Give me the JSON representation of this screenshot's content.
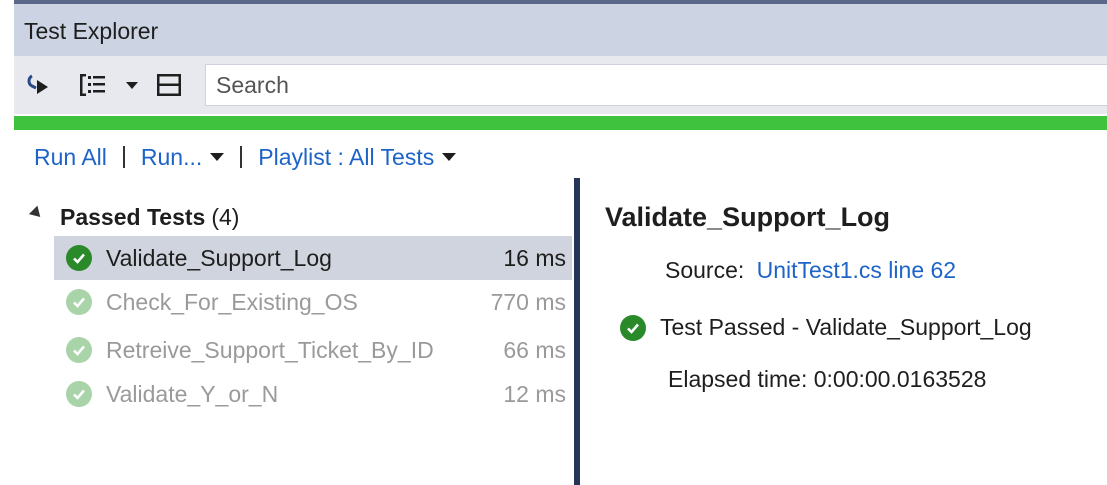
{
  "window": {
    "title": "Test Explorer"
  },
  "toolbar": {
    "icons": [
      "run-test-icon",
      "group-by-icon",
      "dropdown-caret-icon",
      "playlist-icon"
    ],
    "search_placeholder": "Search"
  },
  "progress": {
    "status": "passed",
    "fraction": 1.0,
    "color": "#3fc33f"
  },
  "commands": {
    "run_all": "Run All",
    "run": "Run...",
    "playlist": "Playlist : All Tests"
  },
  "test_list": {
    "group": {
      "title": "Passed Tests",
      "count": "(4)"
    },
    "items": [
      {
        "name": "Validate_Support_Log",
        "duration": "16 ms",
        "selected": true
      },
      {
        "name": "Check_For_Existing_OS",
        "duration": "770 ms",
        "selected": false
      },
      {
        "name": "Retreive_Support_Ticket_By_ID",
        "duration": "66 ms",
        "selected": false
      },
      {
        "name": "Validate_Y_or_N",
        "duration": "12 ms",
        "selected": false
      }
    ]
  },
  "details": {
    "title": "Validate_Support_Log",
    "source_label": "Source:",
    "source_link": "UnitTest1.cs line 62",
    "result": "Test Passed - Validate_Support_Log",
    "elapsed": "Elapsed time: 0:00:00.0163528"
  },
  "colors": {
    "accent_link": "#1e64c8",
    "pass_green": "#2a8a2a",
    "title_bar": "#ccd3e3",
    "divider": "#263458"
  }
}
